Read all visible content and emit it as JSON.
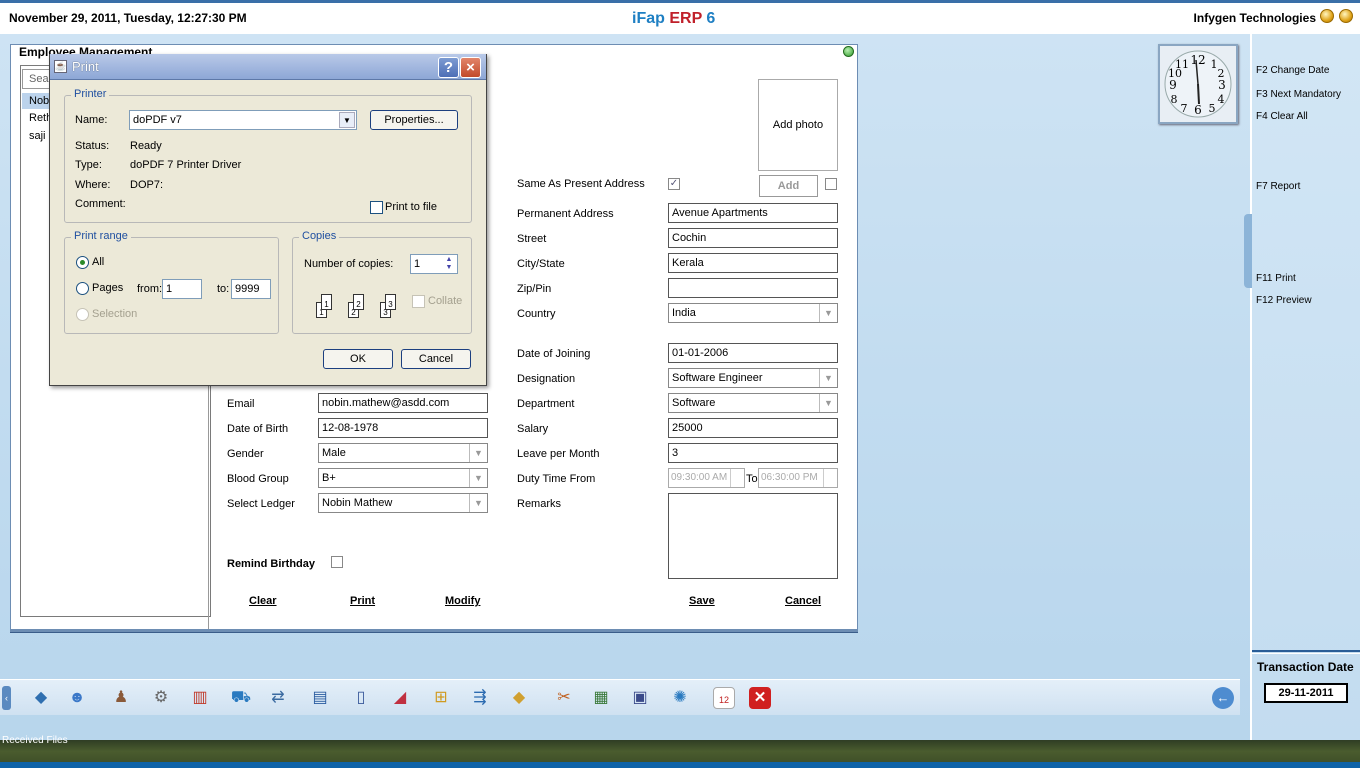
{
  "topbar": {
    "datetime": "November  29, 2011, Tuesday, 12:27:30 PM",
    "title_a": "iFap",
    "title_b": "ERP",
    "title_c": "6",
    "company": "Infygen Technologies"
  },
  "right_panel": {
    "shortcuts": [
      "F2 Change Date",
      "F3 Next Mandatory",
      "F4 Clear All",
      "F7 Report",
      "F11 Print",
      "F12 Preview"
    ],
    "transaction_label": "Transaction Date",
    "transaction_date": "29-11-2011"
  },
  "main_window": {
    "title": "Employee Management",
    "search_placeholder": "Sea",
    "list_items": [
      "Nob",
      "Reth",
      "saji"
    ],
    "photo_label": "Add photo",
    "add_label": "Add",
    "same_as_present_label": "Same As Present  Address",
    "fields_right": {
      "permanent_address_label": "Permanent Address",
      "permanent_address": "Avenue Apartments",
      "street_label": "Street",
      "street": "Cochin",
      "city_label": "City/State",
      "city": "Kerala",
      "zip_label": "Zip/Pin",
      "zip": "",
      "country_label": "Country",
      "country": "India",
      "doj_label": "Date of Joining",
      "doj": "01-01-2006",
      "designation_label": "Designation",
      "designation": "Software Engineer",
      "department_label": "Department",
      "department": "Software",
      "salary_label": "Salary",
      "salary": "25000",
      "leave_label": "Leave per Month",
      "leave": "3",
      "duty_label": "Duty Time From",
      "duty_from": "09:30:00 AM",
      "duty_to_label": "To",
      "duty_to": "06:30:00 PM",
      "remarks_label": "Remarks"
    },
    "fields_left": {
      "email_label": "Email",
      "email": "nobin.mathew@asdd.com",
      "dob_label": "Date of Birth",
      "dob": "12-08-1978",
      "gender_label": "Gender",
      "gender": "Male",
      "blood_label": "Blood Group",
      "blood": "B+",
      "ledger_label": "Select Ledger",
      "ledger": "Nobin Mathew",
      "remind_label": "Remind Birthday"
    },
    "buttons": {
      "clear": "Clear",
      "print": "Print",
      "modify": "Modify",
      "save": "Save",
      "cancel": "Cancel"
    }
  },
  "print_dialog": {
    "title": "Print",
    "help": "?",
    "close": "×",
    "printer_group": "Printer",
    "name_label": "Name:",
    "name_value": "doPDF v7",
    "properties": "Properties...",
    "status_label": "Status:",
    "status_value": "Ready",
    "type_label": "Type:",
    "type_value": "doPDF 7 Printer Driver",
    "where_label": "Where:",
    "where_value": "DOP7:",
    "comment_label": "Comment:",
    "print_to_file": "Print to file",
    "range_group": "Print range",
    "all": "All",
    "pages": "Pages",
    "from_label": "from:",
    "from_value": "1",
    "to_label": "to:",
    "to_value": "9999",
    "selection": "Selection",
    "copies_group": "Copies",
    "copies_label": "Number of copies:",
    "copies_value": "1",
    "collate": "Collate",
    "ok": "OK",
    "cancel": "Cancel"
  },
  "taskbar": {
    "icons": [
      "network-icon",
      "users-icon",
      "contacts-icon",
      "gears-icon",
      "books-icon",
      "cart-icon",
      "exchange-icon",
      "window-icon",
      "document-icon",
      "chart-icon",
      "tree-icon",
      "flow-icon",
      "box-icon",
      "tools-icon",
      "calculator-icon",
      "save-icon",
      "settings-icon",
      "calendar-icon",
      "exit-icon"
    ],
    "calendar_day": "12"
  },
  "footer": {
    "received_files": "Received Files"
  }
}
